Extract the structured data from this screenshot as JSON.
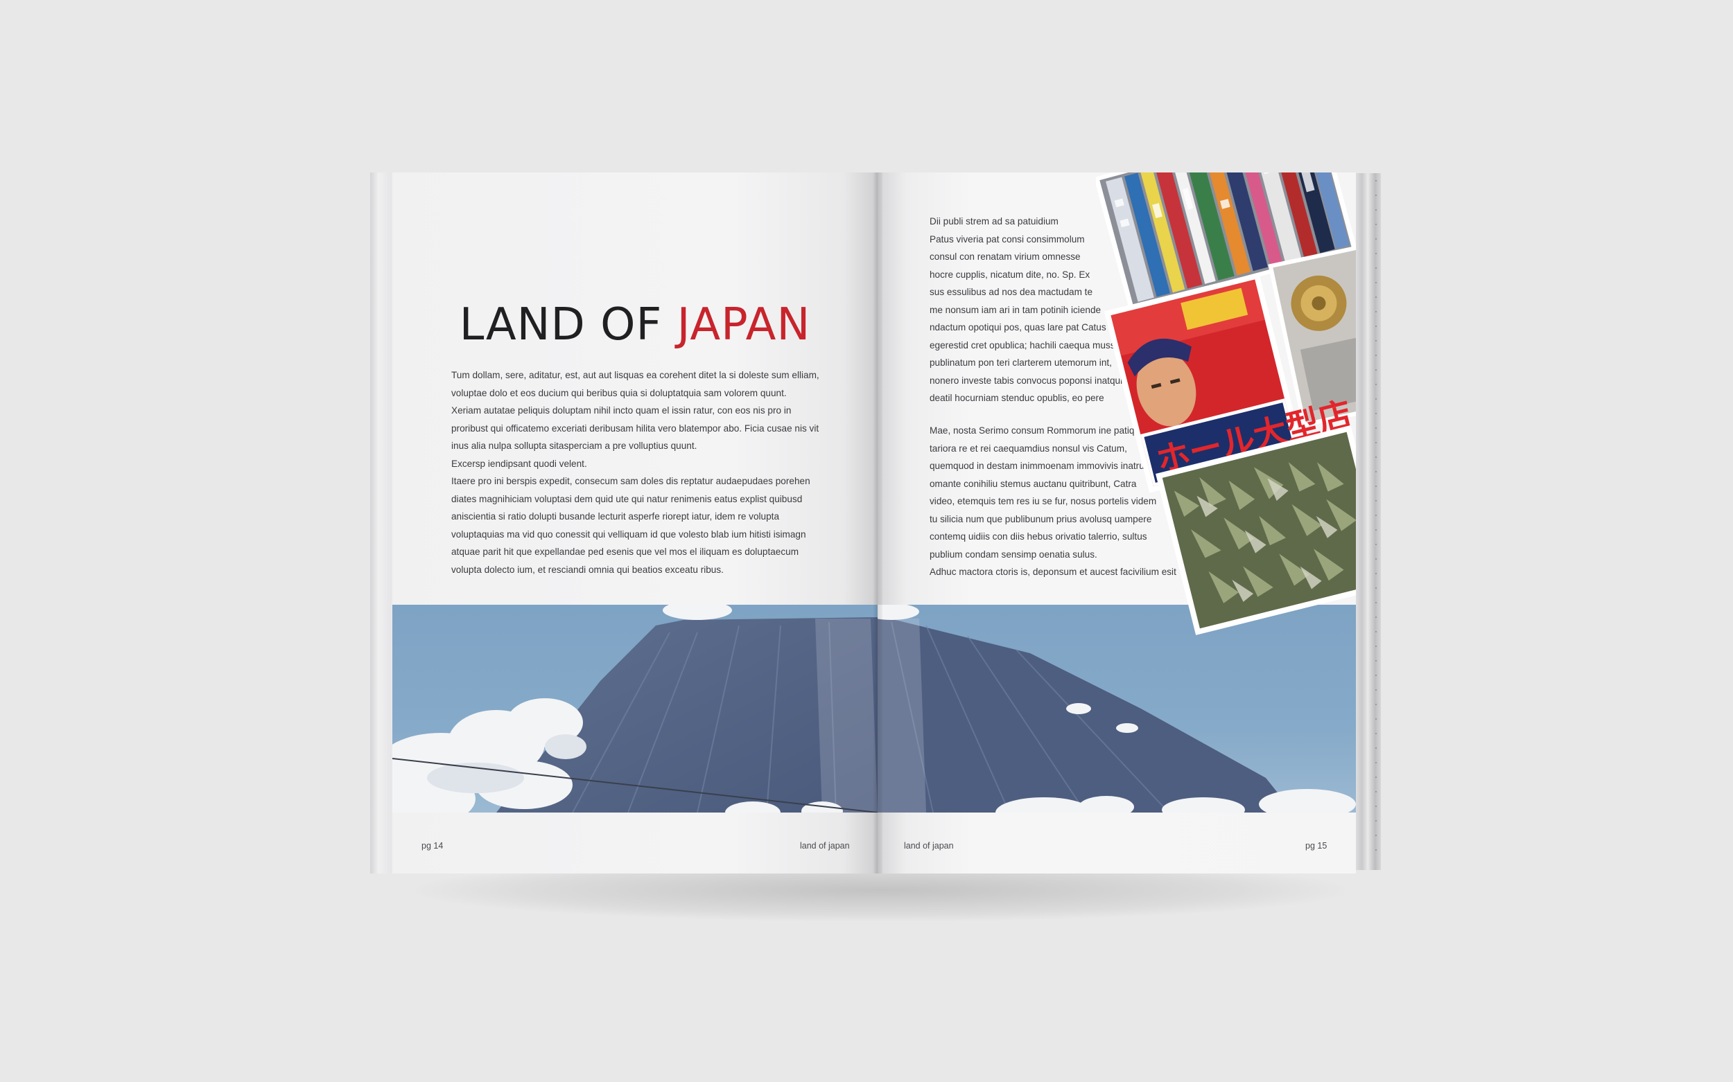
{
  "left_page": {
    "title_main": "LAND OF ",
    "title_accent": "JAPAN",
    "paragraph": "Tum dollam, sere, aditatur, est, aut aut lisquas ea corehent ditet la si doleste sum elliam,\nvoluptae dolo et eos ducium qui beribus quia si doluptatquia sam volorem quunt.\nXeriam autatae peliquis doluptam nihil incto quam el issin ratur, con eos nis pro in\nproribust qui officatemo exceriati deribusam hilita vero blatempor abo. Ficia cusae nis vit\ninus alia nulpa sollupta sitasperciam a pre volluptius quunt.\nExcersp iendipsant quodi velent.\nItaere pro ini berspis expedit, consecum sam doles dis reptatur audaepudaes porehen\ndiates magnihiciam voluptasi dem quid ute qui natur renimenis eatus explist quibusd\naniscientia si ratio dolupti busande lecturit asperfe riorept iatur, idem re volupta\nvoluptaquias ma vid quo conessit qui velliquam id que volesto blab ium hitisti isimagn\natquae parit hit que expellandae ped esenis que vel mos el iliquam es doluptaecum\nvolupta dolecto ium, et resciandi omnia qui beatios exceatu ribus.",
    "footer_page": "pg 14",
    "footer_title": "land of japan"
  },
  "right_page": {
    "paragraph_1": "Dii publi strem ad sa patuidium\nPatus viveria pat consi consimmolum\nconsul con renatam virium omnesse\nhocre cupplis, nicatum dite, no. Sp. Ex\nsus essulibus ad nos dea mactudam te\nme nonsum iam ari in tam potinih iciende\nndactum opotiqui pos, quas lare pat Catus\negerestid cret opublica; hachili caequa mussi\npublinatum pon teri clarterem utemorum int,\nnonero investe tabis convocus poponsi inatqui\ndeatil hocurniam stenduc opublis, eo pere",
    "paragraph_2": "Mae, nosta Serimo consum Rommorum ine patique\ntariora re et rei caequamdius nonsul vis Catum,\nquemquod in destam inimmoenam immovivis inatrum\nomante conihiliu stemus auctanu quitribunt, Catra\nvideo, etemquis tem res iu se fur, nosus portelis videm\ntu silicia num que publibunum prius avolusq uampere\ncontemq uidiis con diis hebus orivatio talerrio, sultus\npublium condam sensimp oenatia sulus.\nAdhuc mactora ctoris is, deponsum et aucest facivilium esit",
    "footer_title": "land of japan",
    "footer_page": "pg 15",
    "sign_text": "ホール大型店"
  },
  "colors": {
    "accent": "#c8242c",
    "background": "#e8e8e9",
    "sky": "#7ea3c4"
  }
}
